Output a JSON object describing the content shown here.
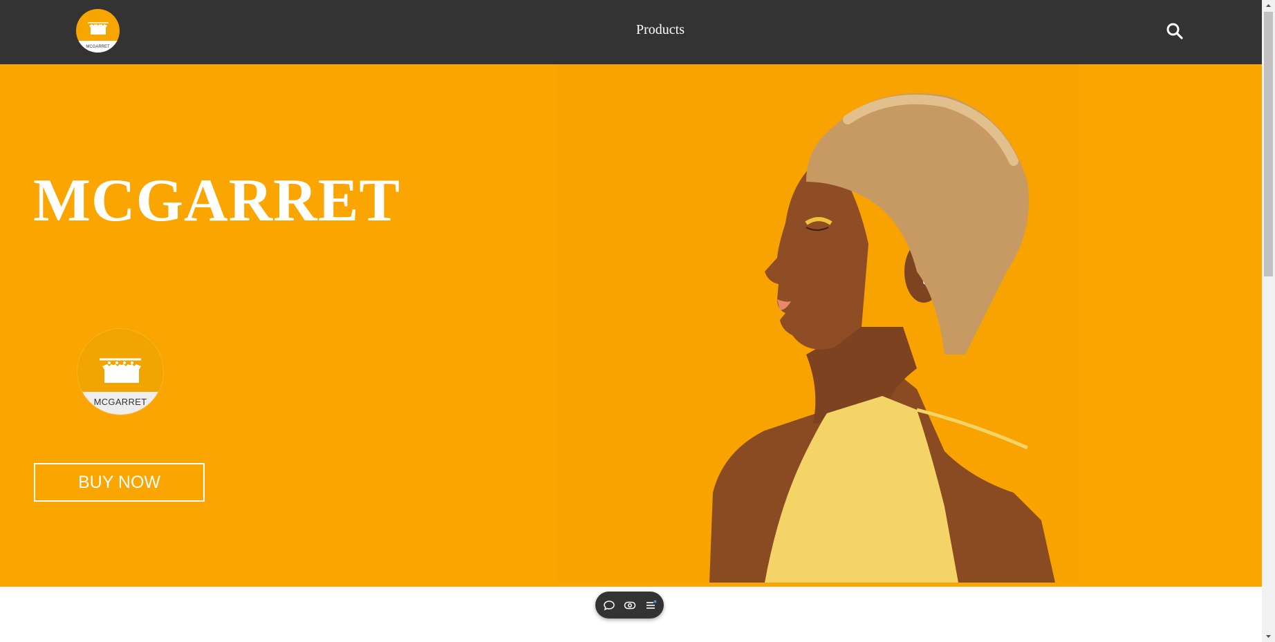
{
  "header": {
    "logo_text": "MCGARRET",
    "nav_label": "Products",
    "search_icon": "search-icon"
  },
  "hero": {
    "title": "MCGARRET",
    "badge_text": "MCGARRET",
    "cta_label": "BUY NOW",
    "photo": "woman-profile-photo"
  },
  "float_toolbar": {
    "icons": [
      "chat-icon",
      "eye-icon",
      "menu-icon"
    ]
  },
  "colors": {
    "header_bg": "#333333",
    "hero_bg": "#fba500",
    "text_on_dark": "#ffffff",
    "accent_dot": "#4a90e2"
  }
}
